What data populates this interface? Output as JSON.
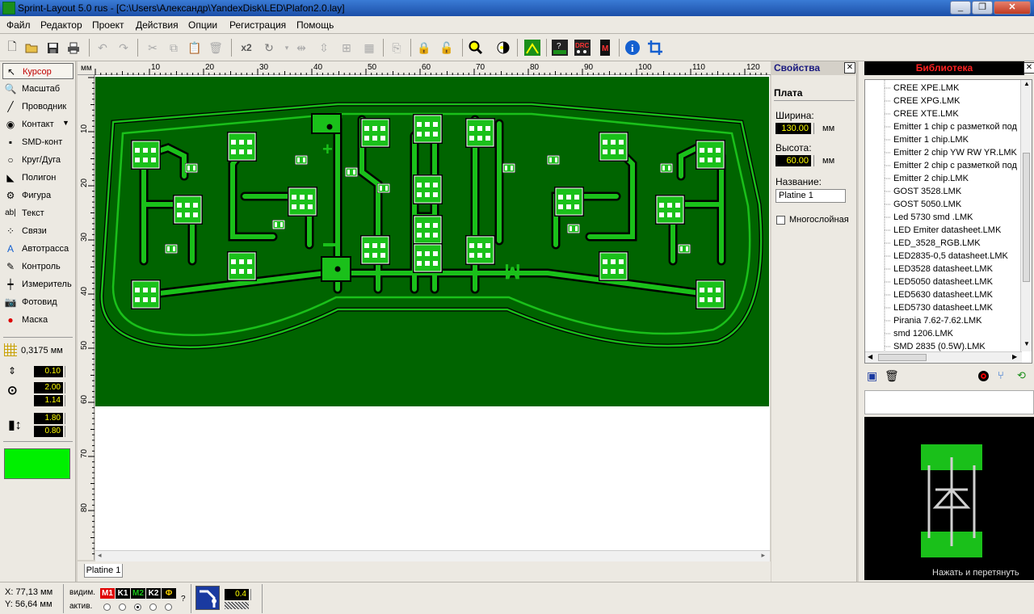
{
  "window": {
    "title": "Sprint-Layout 5.0 rus    - [C:\\Users\\Александр\\YandexDisk\\LED\\Plafon2.0.lay]",
    "minimize": "_",
    "restore": "❐",
    "close": "✕"
  },
  "menu": [
    "Файл",
    "Редактор",
    "Проект",
    "Действия",
    "Опции",
    "Регистрация",
    "Помощь"
  ],
  "toolbar": {
    "new": "new-file-icon",
    "open": "open-folder-icon",
    "save": "save-icon",
    "print": "print-icon",
    "undo": "undo-icon",
    "redo": "redo-icon",
    "cut": "cut-icon",
    "copy": "copy-icon",
    "paste": "paste-icon",
    "delete": "delete-icon",
    "x2_label": "x2",
    "zoom": "zoom-icon",
    "help": "info-icon"
  },
  "tools": [
    {
      "label": "Курсор",
      "icon": "cursor-icon"
    },
    {
      "label": "Масштаб",
      "icon": "zoom-icon"
    },
    {
      "label": "Проводник",
      "icon": "track-icon"
    },
    {
      "label": "Контакт",
      "icon": "pad-icon"
    },
    {
      "label": "SMD-конт",
      "icon": "smd-pad-icon"
    },
    {
      "label": "Круг/Дуга",
      "icon": "circle-icon"
    },
    {
      "label": "Полигон",
      "icon": "polygon-icon"
    },
    {
      "label": "Фигура",
      "icon": "shape-icon"
    },
    {
      "label": "Текст",
      "icon": "text-icon"
    },
    {
      "label": "Связи",
      "icon": "connections-icon"
    },
    {
      "label": "Автотрасса",
      "icon": "autoroute-icon"
    },
    {
      "label": "Контроль",
      "icon": "test-icon"
    },
    {
      "label": "Измеритель",
      "icon": "measure-icon"
    },
    {
      "label": "Фотовид",
      "icon": "photoview-icon"
    },
    {
      "label": "Маска",
      "icon": "mask-icon"
    }
  ],
  "grid": "0,3175 мм",
  "track_width": "0.10",
  "pad_outer": "2.00",
  "pad_inner": "1.14",
  "smd_w": "1.80",
  "smd_h": "0.80",
  "ruler": {
    "unit": "мм",
    "x_ticks": [
      "10",
      "20",
      "30",
      "40",
      "50",
      "60",
      "70",
      "80",
      "90",
      "100",
      "110",
      "120"
    ],
    "y_ticks": [
      "10",
      "20",
      "30",
      "40",
      "50",
      "60",
      "70",
      "80"
    ]
  },
  "tab_label": "Platine 1",
  "props": {
    "title": "Свойства",
    "section": "Плата",
    "width_label": "Ширина:",
    "width_value": "130.00",
    "height_label": "Высота:",
    "height_value": "60.00",
    "unit": "мм",
    "name_label": "Название:",
    "name_value": "Platine 1",
    "multilayer": "Многослойная"
  },
  "library": {
    "title": "Библиотека",
    "items": [
      "CREE XPE.LMK",
      "CREE XPG.LMK",
      "CREE XTE.LMK",
      "Emitter 1 chip с разметкой под",
      "Emitter 1 chip.LMK",
      "Emitter 2 chip YW RW  YR.LMK",
      "Emitter 2 chip с разметкой под",
      "Emitter 2 chip.LMK",
      "GOST 3528.LMK",
      "GOST 5050.LMK",
      "Led 5730 smd .LMK",
      "LED Emiter datasheet.LMK",
      "LED_3528_RGB.LMK",
      "LED2835-0,5 datasheet.LMK",
      "LED3528 datasheet.LMK",
      "LED5050 datasheet.LMK",
      "LED5630 datasheet.LMK",
      "LED5730 datasheet.LMK",
      "Pirania 7.62-7.62.LMK",
      "smd 1206.LMK",
      "SMD 2835 (0.5W).LMK"
    ],
    "hint": "Нажать и перетянуть"
  },
  "status": {
    "x": "X:  77,13 мм",
    "y": "Y:  56,64 мм",
    "visible_label": "видим.",
    "active_label": "актив.",
    "layers": [
      "M1",
      "K1",
      "M2",
      "K2",
      "Ф"
    ],
    "help_mark": "?",
    "track_value": "0.4"
  },
  "board_text": "ꟽ"
}
